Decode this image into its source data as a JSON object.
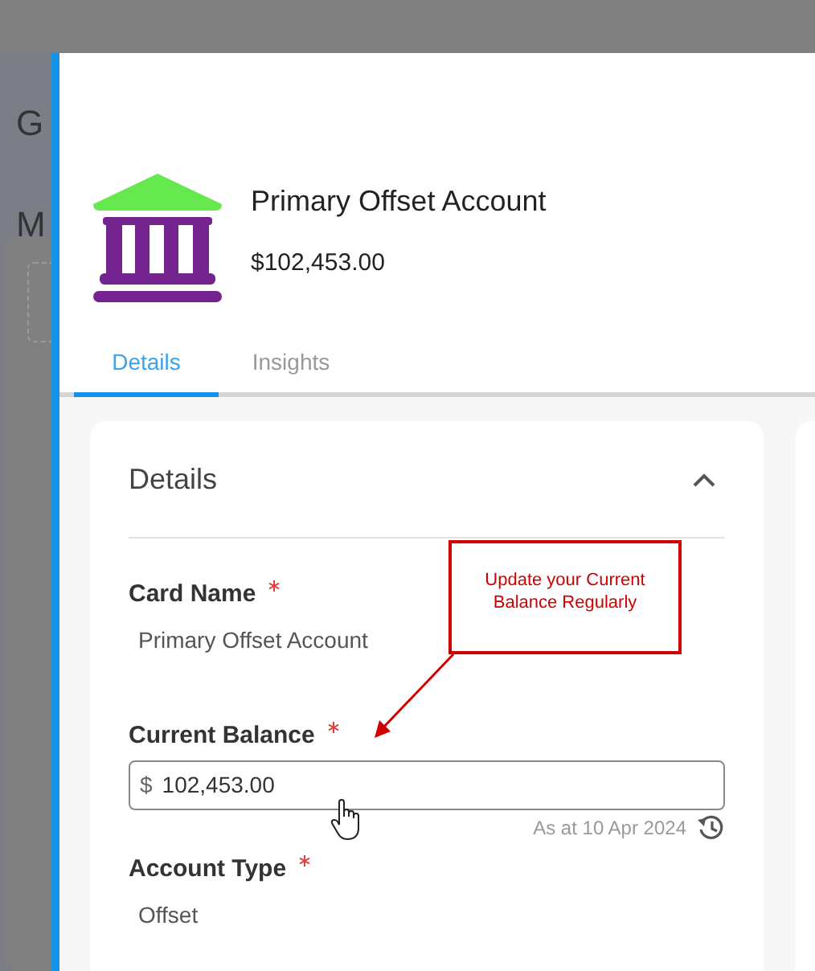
{
  "background": {
    "texts": [
      "G",
      "M"
    ]
  },
  "account": {
    "title": "Primary Offset Account",
    "amount": "$102,453.00"
  },
  "tabs": [
    {
      "label": "Details",
      "selected": true
    },
    {
      "label": "Insights",
      "selected": false
    }
  ],
  "details": {
    "title": "Details",
    "expanded": true,
    "fields": [
      {
        "kind": "text",
        "label": "Card Name",
        "required": true,
        "value": "Primary Offset Account"
      },
      {
        "kind": "currency",
        "label": "Current Balance",
        "required": true,
        "prefix": "$",
        "value": "102,453.00",
        "note": "As at 10 Apr 2024"
      },
      {
        "kind": "text",
        "label": "Account Type",
        "required": true,
        "value": "Offset"
      }
    ]
  },
  "annotation": {
    "text": "Update your Current Balance Regularly"
  }
}
